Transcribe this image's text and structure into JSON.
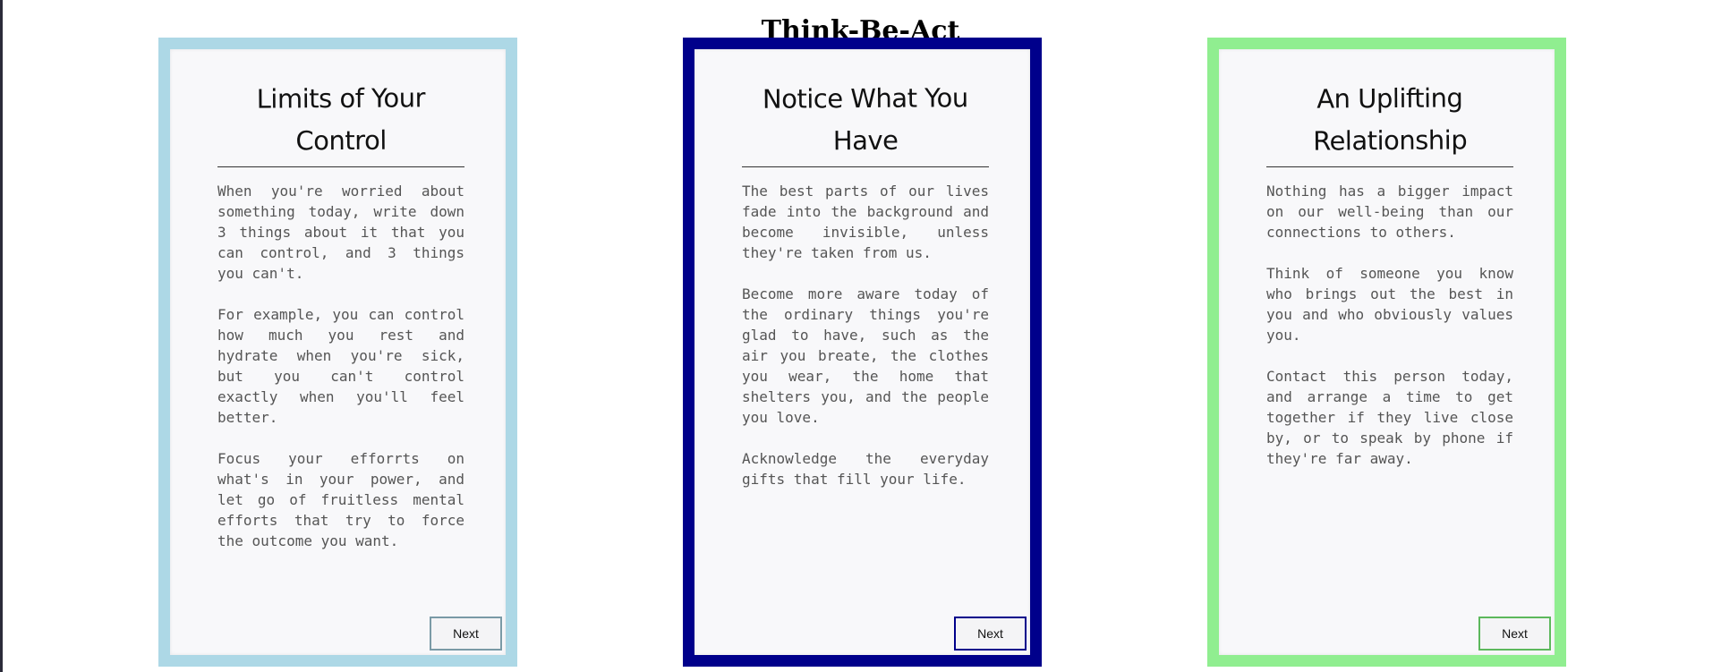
{
  "page": {
    "title": "Think-Be-Act"
  },
  "cards": [
    {
      "title": "Limits of Your Control",
      "border_color": "#add8e6",
      "paragraphs": [
        "When you're worried about something today, write down 3 things about it that you can control, and 3 things you can't.",
        "For example, you can control how much you rest and hydrate when you're sick, but you can't control exactly when you'll feel better.",
        "Focus your efforrts on what's in your power, and let go of fruitless mental efforts that try to force the outcome you want."
      ],
      "next_label": "Next"
    },
    {
      "title": "Notice What You Have",
      "border_color": "#00008b",
      "paragraphs": [
        "The best parts of our lives fade into the background and become invisible, unless they're taken from us.",
        "Become more aware today of the ordinary things you're glad to have, such as the air you breate, the clothes you wear, the home that shelters you, and the people you love.",
        "Acknowledge the everyday gifts that fill your life."
      ],
      "next_label": "Next"
    },
    {
      "title": "An Uplifting Relationship",
      "border_color": "#90ee90",
      "paragraphs": [
        "Nothing has a bigger impact on our well-being than our connections to others.",
        "Think of someone you know who brings out the best in you and who obviously values you.",
        "Contact this person today, and arrange a time to get together if they live close by, or to speak by phone if they're far away."
      ],
      "next_label": "Next"
    }
  ]
}
